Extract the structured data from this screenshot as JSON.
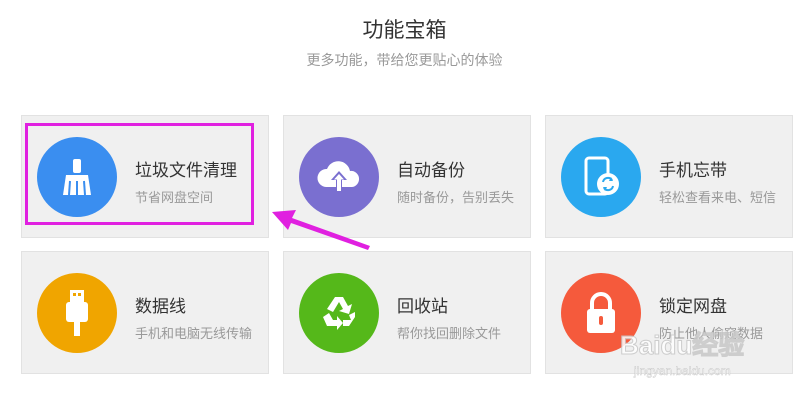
{
  "header": {
    "title": "功能宝箱",
    "subtitle": "更多功能，带给您更贴心的体验"
  },
  "cards": [
    {
      "name": "垃圾文件清理",
      "desc": "节省网盘空间",
      "icon": "broom-icon",
      "color": "#3a8ef0"
    },
    {
      "name": "自动备份",
      "desc": "随时备份，告别丢失",
      "icon": "cloud-upload-icon",
      "color": "#7a6fd0"
    },
    {
      "name": "手机忘带",
      "desc": "轻松查看来电、短信",
      "icon": "phone-sync-icon",
      "color": "#2aa8ef"
    },
    {
      "name": "数据线",
      "desc": "手机和电脑无线传输",
      "icon": "usb-icon",
      "color": "#f0a500"
    },
    {
      "name": "回收站",
      "desc": "帮你找回删除文件",
      "icon": "recycle-icon",
      "color": "#55b81a"
    },
    {
      "name": "锁定网盘",
      "desc": "防止他人偷窥数据",
      "icon": "lock-icon",
      "color": "#f55a3c"
    }
  ],
  "annotation": {
    "highlight_color": "#e020e0"
  },
  "watermark": {
    "logo": "Baidu经验",
    "url": "jingyan.baidu.com"
  }
}
